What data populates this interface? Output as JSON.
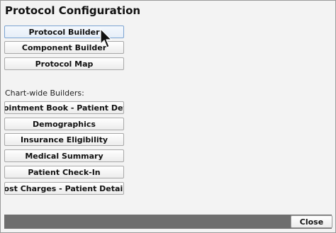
{
  "window": {
    "title": "Protocol Configuration"
  },
  "main_buttons": [
    {
      "label": "Protocol Builder",
      "state": "hover"
    },
    {
      "label": "Component Builder"
    },
    {
      "label": "Protocol Map"
    }
  ],
  "chart_wide": {
    "label": "Chart-wide Builders:",
    "buttons": [
      {
        "label": "Appointment Book - Patient Details"
      },
      {
        "label": "Demographics"
      },
      {
        "label": "Insurance Eligibility"
      },
      {
        "label": "Medical Summary"
      },
      {
        "label": "Patient Check-In"
      },
      {
        "label": "Post Charges - Patient Details"
      }
    ]
  },
  "footer": {
    "close_label": "Close"
  },
  "colors": {
    "hover_border": "#7ba3d1",
    "footer_bar": "#6e6e6e"
  },
  "icons": {
    "cursor": "mouse-pointer-icon"
  }
}
